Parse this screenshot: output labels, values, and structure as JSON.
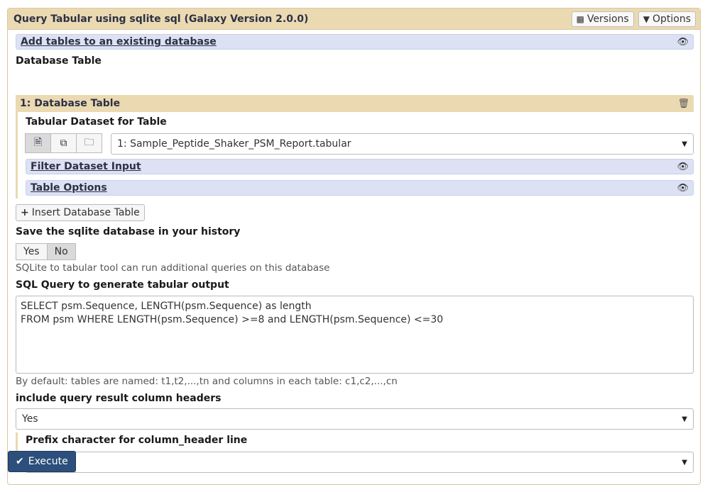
{
  "tool": {
    "title": "Query Tabular using sqlite sql (Galaxy Version 2.0.0)",
    "versions_label": "Versions",
    "options_label": "Options"
  },
  "add_tables_section": {
    "label": "Add tables to an existing database"
  },
  "database_table": {
    "heading": "Database Table",
    "repeat_title": "1: Database Table",
    "dataset_label": "Tabular Dataset for Table",
    "dataset_value": "1: Sample_Peptide_Shaker_PSM_Report.tabular",
    "filter_section": "Filter Dataset Input",
    "table_options_section": "Table Options"
  },
  "insert_button": {
    "label": "Insert Database Table"
  },
  "save_db": {
    "label": "Save the sqlite database in your history",
    "options": [
      "Yes",
      "No"
    ],
    "selected": "No",
    "help": "SQLite to tabular tool can run additional queries on this database"
  },
  "sql_query": {
    "label": "SQL Query to generate tabular output",
    "value": "SELECT psm.Sequence, LENGTH(psm.Sequence) as length\nFROM psm WHERE LENGTH(psm.Sequence) >=8 and LENGTH(psm.Sequence) <=30",
    "help": "By default: tables are named: t1,t2,...,tn and columns in each table: c1,c2,...,cn"
  },
  "headers": {
    "label": "include query result column headers",
    "value": "Yes"
  },
  "prefix": {
    "label": "Prefix character for column_header line",
    "value": "#"
  },
  "execute": {
    "label": "Execute"
  }
}
